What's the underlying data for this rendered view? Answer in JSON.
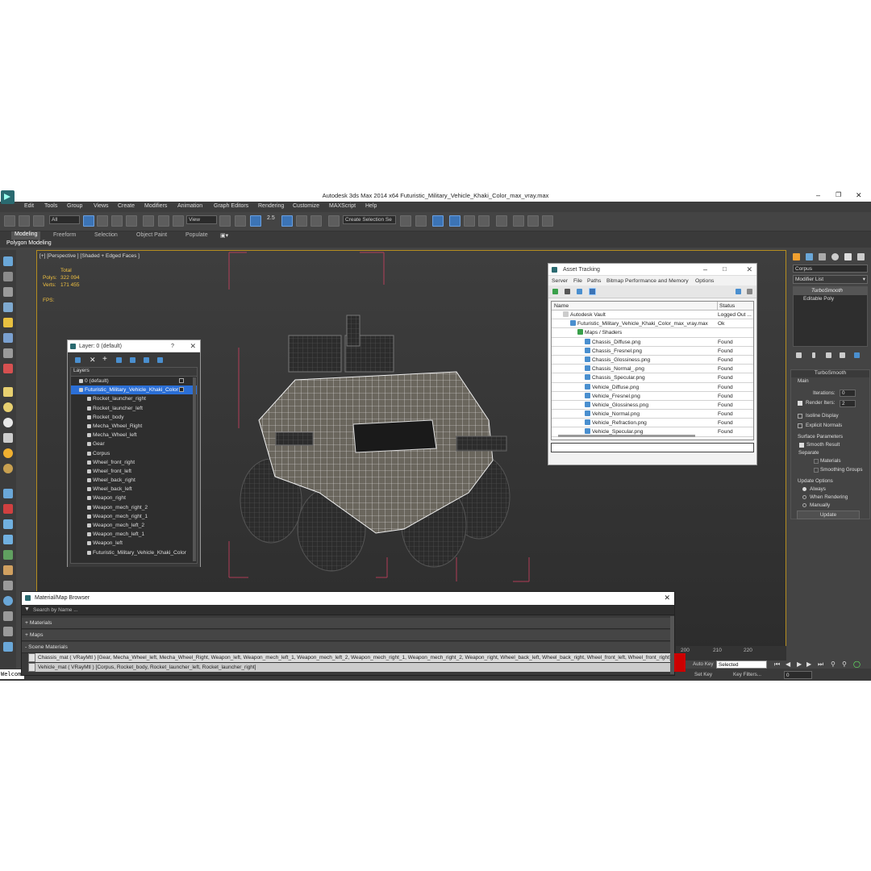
{
  "window": {
    "title": "Autodesk 3ds Max  2014 x64     Futuristic_Military_Vehicle_Khaki_Color_max_vray.max"
  },
  "menu": [
    "Edit",
    "Tools",
    "Group",
    "Views",
    "Create",
    "Modifiers",
    "Animation",
    "Graph Editors",
    "Rendering",
    "Customize",
    "MAXScript",
    "Help"
  ],
  "toolbar": {
    "selection_filter": "All",
    "ref_coord": "View",
    "snap_value": "2.5",
    "named_selection": "Create Selection Se"
  },
  "ribbon": {
    "tabs": [
      "Modeling",
      "Freeform",
      "Selection",
      "Object Paint",
      "Populate"
    ],
    "active": "Modeling",
    "sub_label": "Polygon Modeling"
  },
  "viewport": {
    "label": "[+] [Perspective ] [Shaded + Edged Faces ]",
    "stats": {
      "total_label": "Total",
      "polys_label": "Polys:",
      "polys_value": "322 094",
      "verts_label": "Verts:",
      "verts_value": "171 455",
      "fps_label": "FPS:"
    }
  },
  "layer_dialog": {
    "title": "Layer: 0 (default)",
    "help": "?",
    "header": "Layers",
    "items": [
      {
        "label": "0 (default)",
        "level": 0
      },
      {
        "label": "Futuristic_Military_Vehicle_Khaki_Color",
        "level": 0,
        "selected": true
      },
      {
        "label": "Rocket_launcher_right",
        "level": 1
      },
      {
        "label": "Rocket_launcher_left",
        "level": 1
      },
      {
        "label": "Rocket_body",
        "level": 1
      },
      {
        "label": "Mecha_Wheel_Right",
        "level": 1
      },
      {
        "label": "Mecha_Wheel_left",
        "level": 1
      },
      {
        "label": "Gear",
        "level": 1
      },
      {
        "label": "Corpus",
        "level": 1
      },
      {
        "label": "Wheel_front_right",
        "level": 1
      },
      {
        "label": "Wheel_front_left",
        "level": 1
      },
      {
        "label": "Wheel_back_right",
        "level": 1
      },
      {
        "label": "Wheel_back_left",
        "level": 1
      },
      {
        "label": "Weapon_right",
        "level": 1
      },
      {
        "label": "Weapon_mech_right_2",
        "level": 1
      },
      {
        "label": "Weapon_mech_right_1",
        "level": 1
      },
      {
        "label": "Weapon_mech_left_2",
        "level": 1
      },
      {
        "label": "Weapon_mech_left_1",
        "level": 1
      },
      {
        "label": "Weapon_left",
        "level": 1
      },
      {
        "label": "Futuristic_Military_Vehicle_Khaki_Color",
        "level": 1
      }
    ]
  },
  "asset_tracking": {
    "title": "Asset Tracking",
    "menu": [
      "Server",
      "File",
      "Paths",
      "Bitmap Performance and Memory",
      "Options"
    ],
    "columns": {
      "name": "Name",
      "status": "Status"
    },
    "rows": [
      {
        "name": "Autodesk Vault",
        "status": "Logged Out ...",
        "level": 0
      },
      {
        "name": "Futuristic_Military_Vehicle_Khaki_Color_max_vray.max",
        "status": "Ok",
        "level": 1
      },
      {
        "name": "Maps / Shaders",
        "status": "",
        "level": 2
      },
      {
        "name": "Chassis_Diffuse.png",
        "status": "Found",
        "level": 3
      },
      {
        "name": "Chassis_Fresnel.png",
        "status": "Found",
        "level": 3
      },
      {
        "name": "Chassis_Glossiness.png",
        "status": "Found",
        "level": 3
      },
      {
        "name": "Chassis_Normal_.png",
        "status": "Found",
        "level": 3
      },
      {
        "name": "Chassis_Specular.png",
        "status": "Found",
        "level": 3
      },
      {
        "name": "Vehicle_Diffuse.png",
        "status": "Found",
        "level": 3
      },
      {
        "name": "Vehicle_Fresnel.png",
        "status": "Found",
        "level": 3
      },
      {
        "name": "Vehicle_Glossiness.png",
        "status": "Found",
        "level": 3
      },
      {
        "name": "Vehicle_Normal.png",
        "status": "Found",
        "level": 3
      },
      {
        "name": "Vehicle_Refraction.png",
        "status": "Found",
        "level": 3
      },
      {
        "name": "Vehicle_Specular.png",
        "status": "Found",
        "level": 3
      }
    ]
  },
  "command_panel": {
    "object_name": "Corpus",
    "modifier_list": "Modifier List",
    "stack": [
      "TurboSmooth",
      "Editable Poly"
    ],
    "rollout_title": "TurboSmooth",
    "main_label": "Main",
    "iterations_label": "Iterations:",
    "iterations_value": "0",
    "render_iters_label": "Render Iters:",
    "render_iters_value": "2",
    "isoline_label": "Isoline Display",
    "explicit_label": "Explicit Normals",
    "surface_label": "Surface Parameters",
    "smooth_result_label": "Smooth Result",
    "separate_label": "Separate",
    "materials_label": "Materials",
    "smoothing_label": "Smoothing Groups",
    "update_options_label": "Update Options",
    "always_label": "Always",
    "when_rendering_label": "When Rendering",
    "manually_label": "Manually",
    "update_button": "Update"
  },
  "material_browser": {
    "title": "Material/Map Browser",
    "search_placeholder": "Search by Name ...",
    "groups": [
      "+ Materials",
      "+ Maps",
      "- Scene Materials"
    ],
    "materials": [
      "Chassis_mat  ( VRayMtl ) [Gear, Mecha_Wheel_left, Mecha_Wheel_Right, Weapon_left, Weapon_mech_left_1, Weapon_mech_left_2, Weapon_mech_right_1, Weapon_mech_right_2, Weapon_right, Wheel_back_left, Wheel_back_right, Wheel_front_left, Wheel_front_right]",
      "Vehicle_mat  ( VRayMtl ) [Corpus, Rocket_body, Rocket_launcher_left, Rocket_launcher_right]"
    ]
  },
  "timeline": {
    "ticks": [
      "200",
      "210",
      "220"
    ]
  },
  "status": {
    "maxscript": "Welcom",
    "auto_key": "Auto Key",
    "set_key": "Set Key",
    "key_mode": "Selected",
    "key_filters": "Key Filters...",
    "frame": "0"
  },
  "colors": {
    "accent_blue": "#3c74b6",
    "viewport_border": "#b58d20",
    "stats_yellow": "#f0c040"
  }
}
